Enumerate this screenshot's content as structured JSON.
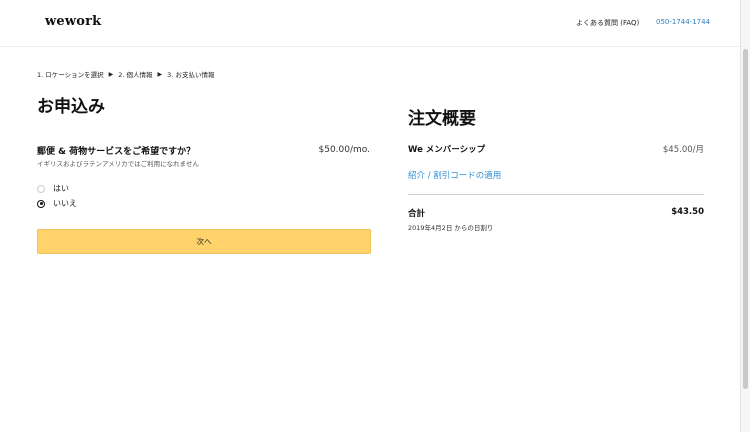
{
  "header": {
    "logo": "wework",
    "faq_label": "よくある質問 (FAQ)",
    "phone": "050-1744-1744"
  },
  "breadcrumb": {
    "steps": [
      "1. ロケーションを選択",
      "2. 個人情報",
      "3. お支払い情報"
    ],
    "separator": "▶"
  },
  "form": {
    "title": "お申込み",
    "question": "郵便 & 荷物サービスをご希望ですか？",
    "question_note": "イギリスおよびラテンアメリカではご利用になれません",
    "price": "$50.00/mo.",
    "options": [
      {
        "label": "はい",
        "selected": false
      },
      {
        "label": "いいえ",
        "selected": true
      }
    ],
    "next_label": "次へ"
  },
  "summary": {
    "title": "注文概要",
    "item_label": "We メンバーシップ",
    "item_price": "$45.00/月",
    "promo_link": "紹介 / 割引コードの適用",
    "total_label": "合計",
    "total_value": "$43.50",
    "total_note": "2019年4月2日 からの日割り"
  },
  "colors": {
    "accent_button": "#ffd26b",
    "link": "#2d8fd6",
    "phone": "#2d7fc1"
  }
}
